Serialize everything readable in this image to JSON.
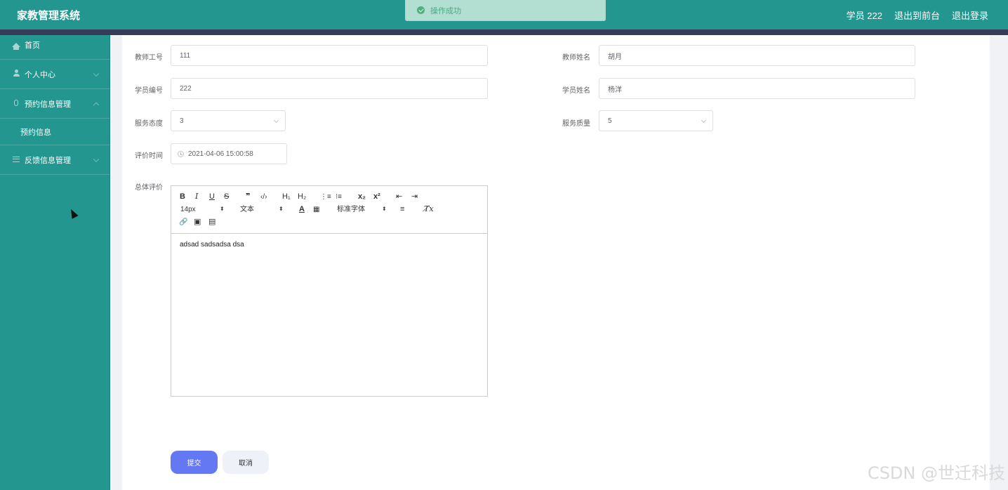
{
  "app": {
    "title": "家教管理系统"
  },
  "header": {
    "user_label": "学员 222",
    "to_front_label": "退出到前台",
    "logout_label": "退出登录"
  },
  "toast": {
    "message": "操作成功"
  },
  "sidebar": {
    "items": [
      {
        "label": "首页",
        "icon": "home-icon"
      },
      {
        "label": "个人中心",
        "icon": "user-icon"
      },
      {
        "label": "预约信息管理",
        "icon": "microphone-icon"
      },
      {
        "label": "预约信息"
      },
      {
        "label": "反馈信息管理",
        "icon": "menu-icon"
      }
    ]
  },
  "form": {
    "teacher_id": {
      "label": "教师工号",
      "value": "111"
    },
    "teacher_name": {
      "label": "教师姓名",
      "value": "胡月"
    },
    "student_id": {
      "label": "学员编号",
      "value": "222"
    },
    "student_name": {
      "label": "学员姓名",
      "value": "杨洋"
    },
    "service_attitude": {
      "label": "服务态度",
      "value": "3"
    },
    "service_quality": {
      "label": "服务质量",
      "value": "5"
    },
    "review_time": {
      "label": "评价时间",
      "value": "2021-04-06 15:00:58"
    },
    "overall": {
      "label": "总体评价",
      "content": "adsad sadsadsa dsa"
    }
  },
  "editor": {
    "font_size": "14px",
    "header_picker": "文本",
    "font_family": "标准字体",
    "buttons": {
      "bold": "B",
      "italic": "I",
      "underline": "U",
      "strike": "S",
      "blockquote": "❞",
      "code": "‹/›",
      "h1": "H₁",
      "h2": "H₂",
      "ordered_list": "⋮≡",
      "bullet_list": "⁝≡",
      "subscript": "x₂",
      "superscript": "x²",
      "outdent": "⇤",
      "indent": "⇥",
      "color": "A",
      "background": "▦",
      "align": "≡",
      "clean": "T̸x",
      "link": "🔗",
      "image": "▣",
      "video": "▤"
    }
  },
  "actions": {
    "submit_label": "提交",
    "cancel_label": "取消"
  },
  "watermark": "CSDN @世迁科技"
}
